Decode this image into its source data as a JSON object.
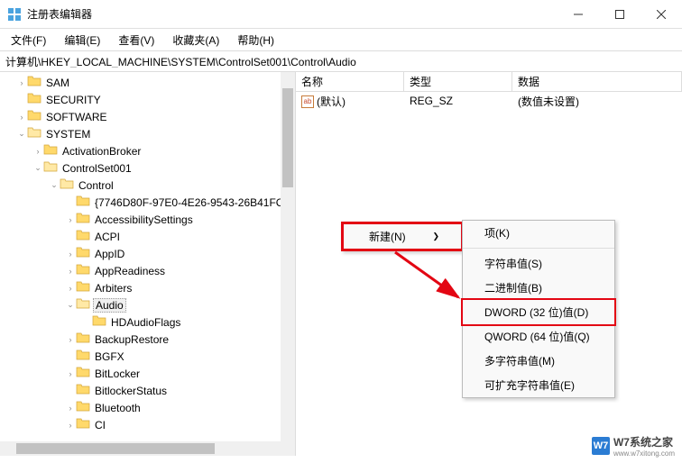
{
  "titlebar": {
    "title": "注册表编辑器"
  },
  "menubar": {
    "file": "文件(F)",
    "edit": "编辑(E)",
    "view": "查看(V)",
    "favorites": "收藏夹(A)",
    "help": "帮助(H)"
  },
  "addrbar": {
    "path": "计算机\\HKEY_LOCAL_MACHINE\\SYSTEM\\ControlSet001\\Control\\Audio"
  },
  "tree": {
    "items": [
      {
        "indent": 1,
        "toggle": ">",
        "label": "SAM"
      },
      {
        "indent": 1,
        "toggle": "",
        "label": "SECURITY"
      },
      {
        "indent": 1,
        "toggle": ">",
        "label": "SOFTWARE"
      },
      {
        "indent": 1,
        "toggle": "v",
        "label": "SYSTEM"
      },
      {
        "indent": 2,
        "toggle": ">",
        "label": "ActivationBroker"
      },
      {
        "indent": 2,
        "toggle": "v",
        "label": "ControlSet001"
      },
      {
        "indent": 3,
        "toggle": "v",
        "label": "Control"
      },
      {
        "indent": 4,
        "toggle": "",
        "label": "{7746D80F-97E0-4E26-9543-26B41FC"
      },
      {
        "indent": 4,
        "toggle": ">",
        "label": "AccessibilitySettings"
      },
      {
        "indent": 4,
        "toggle": "",
        "label": "ACPI"
      },
      {
        "indent": 4,
        "toggle": ">",
        "label": "AppID"
      },
      {
        "indent": 4,
        "toggle": ">",
        "label": "AppReadiness"
      },
      {
        "indent": 4,
        "toggle": ">",
        "label": "Arbiters"
      },
      {
        "indent": 4,
        "toggle": "v",
        "label": "Audio",
        "selected": true
      },
      {
        "indent": 5,
        "toggle": "",
        "label": "HDAudioFlags"
      },
      {
        "indent": 4,
        "toggle": ">",
        "label": "BackupRestore"
      },
      {
        "indent": 4,
        "toggle": "",
        "label": "BGFX"
      },
      {
        "indent": 4,
        "toggle": ">",
        "label": "BitLocker"
      },
      {
        "indent": 4,
        "toggle": "",
        "label": "BitlockerStatus"
      },
      {
        "indent": 4,
        "toggle": ">",
        "label": "Bluetooth"
      },
      {
        "indent": 4,
        "toggle": ">",
        "label": "CI"
      }
    ]
  },
  "list": {
    "headers": {
      "name": "名称",
      "type": "类型",
      "data": "数据"
    },
    "rows": [
      {
        "icon": "ab",
        "name": "(默认)",
        "type": "REG_SZ",
        "data": "(数值未设置)"
      }
    ]
  },
  "context_menu": {
    "new": "新建(N)"
  },
  "submenu": {
    "key": "项(K)",
    "string": "字符串值(S)",
    "binary": "二进制值(B)",
    "dword": "DWORD (32 位)值(D)",
    "qword": "QWORD (64 位)值(Q)",
    "multi": "多字符串值(M)",
    "expand": "可扩充字符串值(E)"
  },
  "watermark": {
    "text": "W7系统之家",
    "sub": "www.w7xitong.com",
    "badge": "W7"
  }
}
